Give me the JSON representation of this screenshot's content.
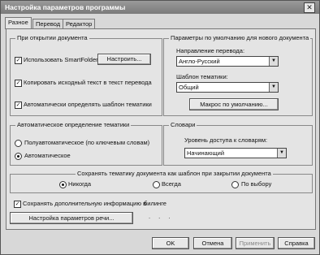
{
  "window": {
    "title": "Настройка параметров программы"
  },
  "tabs": [
    "Разное",
    "Перевод",
    "Редактор"
  ],
  "open_group": {
    "legend": "При открытии документа",
    "smartfolders_label": "Использовать SmartFolders",
    "configure_label": "Настроить...",
    "copy_source_label": "Копировать исходный текст в текст перевода",
    "auto_template_label": "Автоматически определять шаблон тематики"
  },
  "defaults_group": {
    "legend": "Параметры по умолчанию для нового документа",
    "direction_label": "Направление перевода:",
    "direction_value": "Англо-Русский",
    "template_label": "Шаблон тематики:",
    "template_value": "Общий",
    "default_macro_label": "Макрос по умолчанию..."
  },
  "auto_topic_group": {
    "legend": "Автоматическое определение тематики",
    "semi_auto_label": "Полуавтоматическое (по ключевым словам)",
    "auto_label": "Автоматическое"
  },
  "dict_group": {
    "legend": "Словари",
    "access_label": "Уровень доступа к словарям:",
    "access_value": "Начинающий"
  },
  "save_topic_group": {
    "legend": "Сохранять тематику документа как шаблон при закрытии документа",
    "never_label": "Никогда",
    "always_label": "Всегда",
    "choice_label": "По выбору"
  },
  "save_extra_label": "Сохранять дополнительную информацию в",
  "save_extra_word": "билинге",
  "speech_button_label": "Настройка параметров речи...",
  "footer": {
    "ok_label": "OK",
    "cancel_label": "Отмена",
    "apply_label": "Применить",
    "help_label": "Справка"
  }
}
